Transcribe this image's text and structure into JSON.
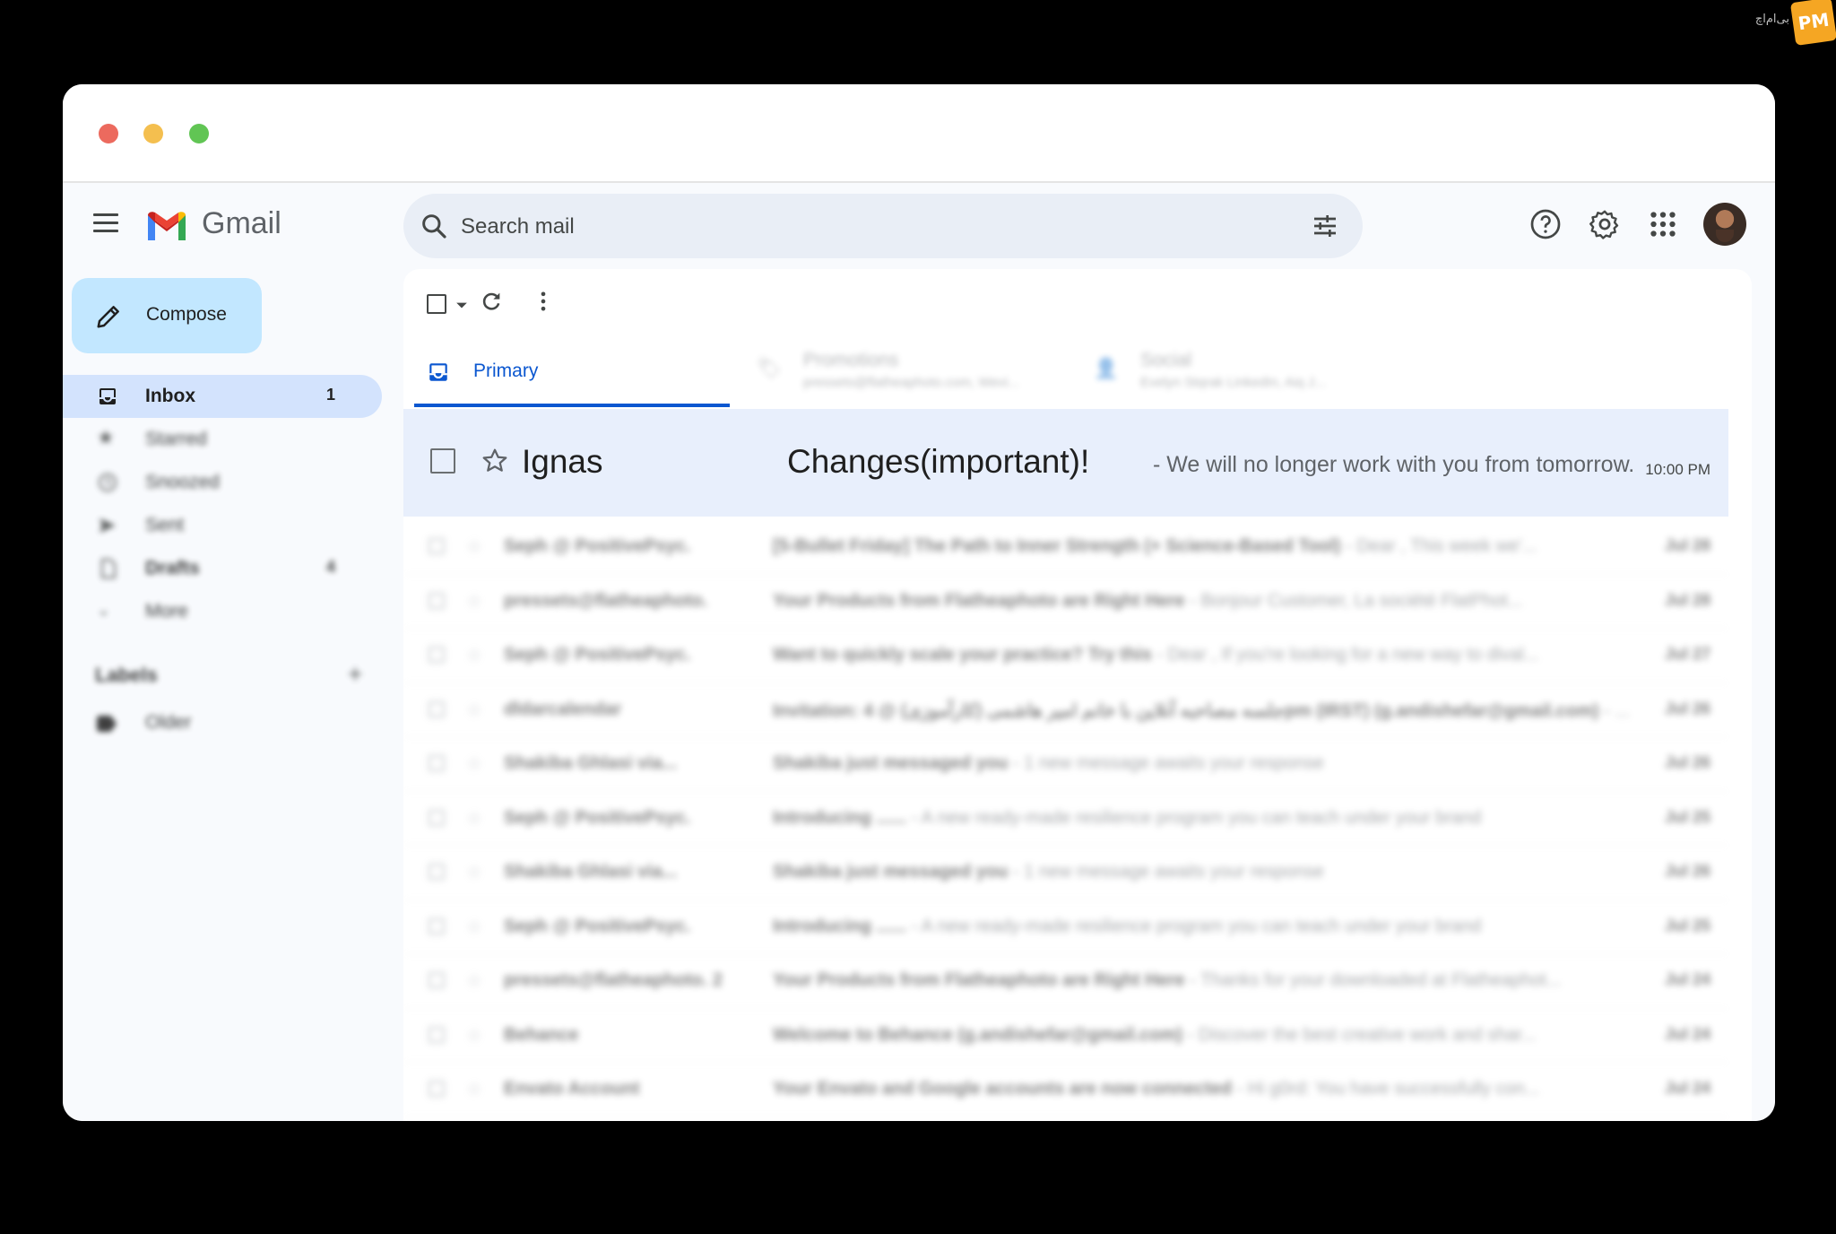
{
  "watermark": {
    "text": "بی‌ام‌اچ",
    "logo": "PM"
  },
  "header": {
    "app_name": "Gmail",
    "search_placeholder": "Search mail",
    "icons": [
      "menu-icon",
      "search-icon",
      "tune-icon",
      "help-icon",
      "settings-icon",
      "apps-icon",
      "avatar"
    ]
  },
  "compose": {
    "label": "Compose"
  },
  "sidebar": {
    "items": [
      {
        "label": "Inbox",
        "count": "1",
        "icon": "inbox-icon"
      },
      {
        "label": "Starred",
        "count": "",
        "icon": "star-icon"
      },
      {
        "label": "Snoozed",
        "count": "",
        "icon": "clock-icon"
      },
      {
        "label": "Sent",
        "count": "",
        "icon": "send-icon"
      },
      {
        "label": "Drafts",
        "count": "4",
        "icon": "draft-icon"
      },
      {
        "label": "More",
        "count": "",
        "icon": "chevron-down-icon"
      }
    ],
    "labels_heading": "Labels",
    "labels_add": "+",
    "labels": [
      {
        "label": "Older"
      }
    ]
  },
  "tabs": [
    {
      "label": "Primary",
      "sub": ""
    },
    {
      "label": "Promotions",
      "sub": "pressets@flatheaphoto.com, Wevi..."
    },
    {
      "label": "Social",
      "sub": "Evelyn Stqrak LinkedIn, Aiq J..."
    }
  ],
  "featured": {
    "sender": "Ignas",
    "subject": "Changes(important)!",
    "snippet": "- We will no longer work with you from tomorrow.",
    "time": "10:00 PM"
  },
  "emails": [
    {
      "sender": "Seph @ PositivePsyc.",
      "subject": "[5-Bullet Friday] The Path to Inner Strength (+ Science-Based Tool)",
      "snippet": " - Dear , This week we'...",
      "date": "Jul 28"
    },
    {
      "sender": "pressets@flatheaphoto.",
      "subject": "Your Products from Flatheaphoto are Right Here",
      "snippet": " - Bonjour Customer, La société FlatPhot...",
      "date": "Jul 28"
    },
    {
      "sender": "Seph @ PositivePsyc.",
      "subject": "Want to quickly scale your practice? Try this",
      "snippet": " - Dear , If you're looking for a new way to dival...",
      "date": "Jul 27"
    },
    {
      "sender": "dldarcalendar",
      "subject": "Invitation: جلسه مصاحبه آنلاین با خانم امیر هاشمی (کارآموزی) @ 4pm (IRST) (g.andishefar@gmail.com)",
      "snippet": " - ...",
      "date": "Jul 26"
    },
    {
      "sender": "Shakiba Ghlasi via...",
      "subject": "Shakiba just messaged you",
      "snippet": " - 1 new message awaits your response",
      "date": "Jul 26"
    },
    {
      "sender": "Seph @ PositivePsyc.",
      "subject": "Introducing ......",
      "snippet": " - A new ready-made resilience program you can teach under your brand",
      "date": "Jul 25"
    },
    {
      "sender": "Shakiba Ghlasi via...",
      "subject": "Shakiba just messaged you",
      "snippet": " - 1 new message awaits your response",
      "date": "Jul 26"
    },
    {
      "sender": "Seph @ PositivePsyc.",
      "subject": "Introducing ......",
      "snippet": " - A new ready-made resilience program you can teach under your brand",
      "date": "Jul 25"
    },
    {
      "sender": "pressets@flatheaphoto. 2",
      "subject": "Your Products from Flatheaphoto are Right Here",
      "snippet": " - Thanks for your downloaded at Flatheaphot...",
      "date": "Jul 24"
    },
    {
      "sender": "Behance",
      "subject": "Welcome to Behance (g.andishefar@gmail.com)",
      "snippet": " - Discover the best creative work and shar...",
      "date": "Jul 24"
    },
    {
      "sender": "Envato Account",
      "subject": "Your Envato and Google accounts are now connected",
      "snippet": " - Hi g0rd: You have successfully con...",
      "date": "Jul 24"
    }
  ],
  "colors": {
    "accent": "#0b57d0",
    "compose_bg": "#c2e7ff",
    "active_nav": "#d3e3fd",
    "featured_bg": "#e8effc"
  }
}
